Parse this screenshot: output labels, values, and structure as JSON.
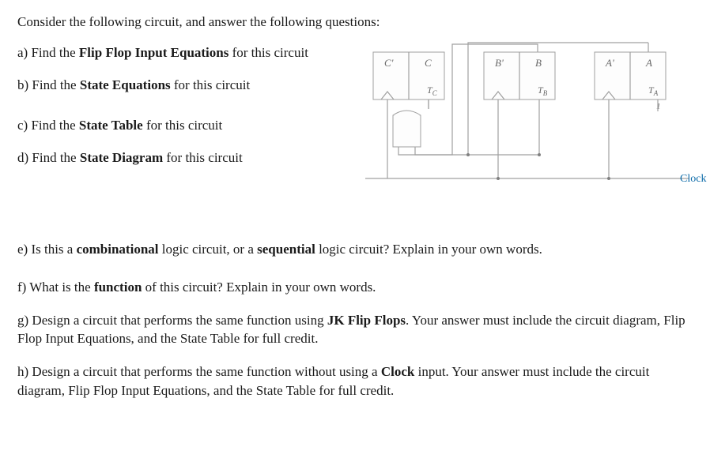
{
  "intro": "Consider the following circuit, and answer the following questions:",
  "q_a_pre": "a) Find the ",
  "q_a_bold": "Flip Flop Input Equations",
  "q_a_post": " for this circuit",
  "q_b_pre": "b) Find the ",
  "q_b_bold": "State Equations",
  "q_b_post": " for this circuit",
  "q_c_pre": "c) Find the ",
  "q_c_bold": "State Table",
  "q_c_post": " for this circuit",
  "q_d_pre": "d) Find the ",
  "q_d_bold": "State Diagram",
  "q_d_post": " for this circuit",
  "q_e_pre": "e) Is this a ",
  "q_e_bold1": "combinational",
  "q_e_mid": " logic circuit, or a ",
  "q_e_bold2": "sequential",
  "q_e_post": " logic circuit? Explain in your own words.",
  "q_f_pre": "f) What is the ",
  "q_f_bold": "function",
  "q_f_post": " of this circuit? Explain in your own words.",
  "q_g_pre": "g) Design a circuit that performs the same function using ",
  "q_g_bold": "JK Flip Flops",
  "q_g_post": ". Your answer must include the circuit diagram, Flip Flop Input Equations, and the State Table for full credit.",
  "q_h_pre": "h) Design a circuit that performs the same function without using a ",
  "q_h_bold": "Clock",
  "q_h_post": " input. Your answer must include the circuit diagram, Flip Flop Input Equations, and the State Table for full credit.",
  "circuit": {
    "ff_c": {
      "qbar": "C'",
      "q": "C",
      "t": "T",
      "tsub": "C"
    },
    "ff_b": {
      "qbar": "B'",
      "q": "B",
      "t": "T",
      "tsub": "B"
    },
    "ff_a": {
      "qbar": "A'",
      "q": "A",
      "t": "T",
      "tsub": "A"
    },
    "const_one": "1",
    "clock": "Clock"
  }
}
